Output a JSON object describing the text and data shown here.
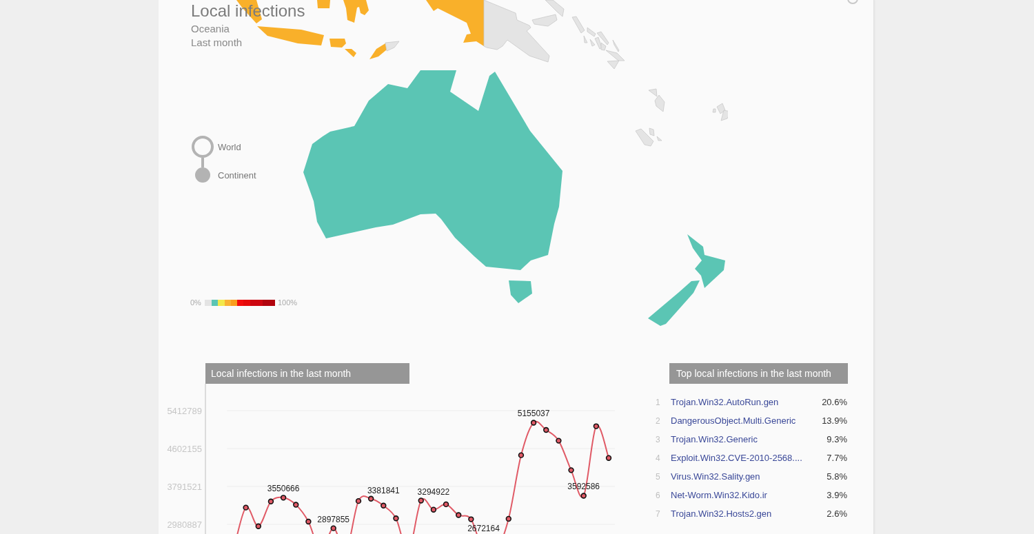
{
  "header": {
    "title": "Local infections",
    "region": "Oceania",
    "period": "Last month"
  },
  "view_switch": [
    {
      "label": "World",
      "selected": false
    },
    {
      "label": "Continent",
      "selected": true
    }
  ],
  "legend": {
    "min_label": "0%",
    "max_label": "100%"
  },
  "infections_chart": {
    "chart_data": [
      {
        "type": "line",
        "title": "Local infections in the last month",
        "color": "#e05a66",
        "marker": "circle",
        "grid": true,
        "yticks": [
          2980887,
          3791521,
          4602155,
          5412789
        ],
        "ylim": [
          2774500,
          5987600
        ],
        "values": [
          null,
          3340000,
          2940000,
          3470000,
          3550666,
          3400000,
          3040000,
          null,
          2897855,
          null,
          3480000,
          3530000,
          3381841,
          3110000,
          null,
          3490000,
          3294922,
          3410000,
          3180000,
          3090000,
          null,
          null,
          3100000,
          4460000,
          5155037,
          5000000,
          4770000,
          4140000,
          3592586,
          5080000,
          4400000
        ],
        "value_labels": [
          null,
          null,
          null,
          null,
          "3550666",
          null,
          null,
          null,
          "2897855",
          null,
          null,
          null,
          "3381841",
          null,
          null,
          null,
          "3294922",
          null,
          null,
          null,
          "2672164",
          null,
          null,
          null,
          "5155037",
          null,
          null,
          null,
          "3592586",
          null,
          null
        ]
      }
    ]
  },
  "top_infections": {
    "title": "Top local infections in the last month",
    "rows": [
      {
        "rank": "1",
        "name": "Trojan.Win32.AutoRun.gen",
        "share": "20.6%"
      },
      {
        "rank": "2",
        "name": "DangerousObject.Multi.Generic",
        "share": "13.9%"
      },
      {
        "rank": "3",
        "name": "Trojan.Win32.Generic",
        "share": "9.3%"
      },
      {
        "rank": "4",
        "name": "Exploit.Win32.CVE-2010-2568....",
        "share": "7.7%"
      },
      {
        "rank": "5",
        "name": "Virus.Win32.Sality.gen",
        "share": "5.8%"
      },
      {
        "rank": "6",
        "name": "Net-Worm.Win32.Kido.ir",
        "share": "3.9%"
      },
      {
        "rank": "7",
        "name": "Trojan.Win32.Hosts2.gen",
        "share": "2.6%"
      }
    ]
  }
}
